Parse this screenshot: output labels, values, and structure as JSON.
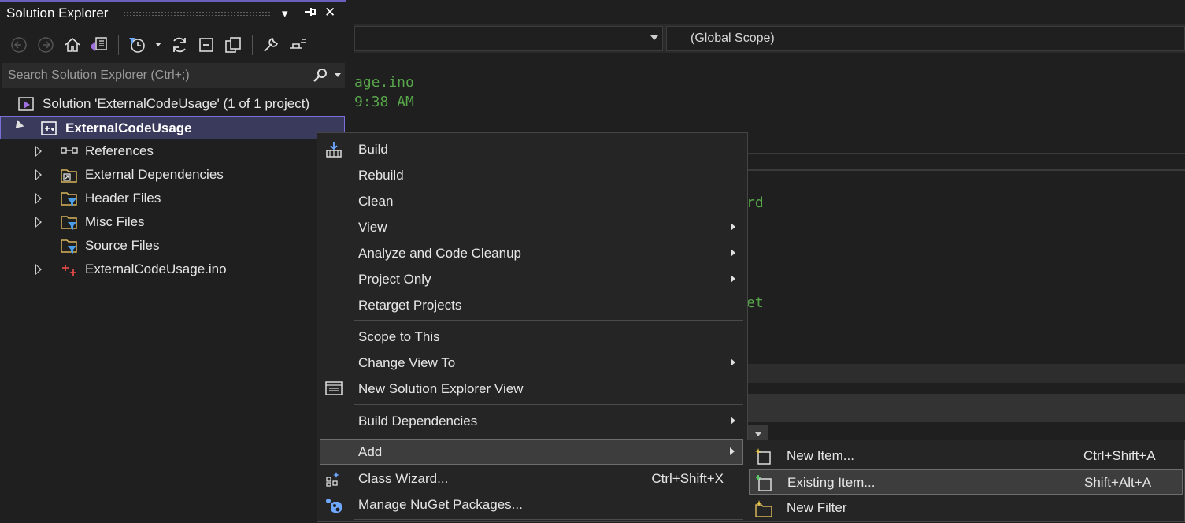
{
  "solution_explorer": {
    "title": "Solution Explorer",
    "title_buttons": {
      "dropdown": "▾",
      "pin": "⊣",
      "close": "✕"
    },
    "search_placeholder": "Search Solution Explorer (Ctrl+;)",
    "toolbar_icons": [
      "back-icon",
      "forward-icon",
      "home-icon",
      "switch-views-icon",
      "pending-changes-filter-icon",
      "sync-icon",
      "collapse-all-icon",
      "show-all-files-icon",
      "properties-icon",
      "preview-icon"
    ],
    "tree": {
      "solution": "Solution 'ExternalCodeUsage' (1 of 1 project)",
      "project": "ExternalCodeUsage",
      "items": [
        {
          "label": "References",
          "icon": "references-icon",
          "expandable": true
        },
        {
          "label": "External Dependencies",
          "icon": "external-deps-icon",
          "expandable": true
        },
        {
          "label": "Header Files",
          "icon": "filter-folder-icon",
          "expandable": true
        },
        {
          "label": "Misc Files",
          "icon": "filter-folder-icon",
          "expandable": true
        },
        {
          "label": "Source Files",
          "icon": "filter-folder-icon",
          "expandable": false
        },
        {
          "label": "ExternalCodeUsage.ino",
          "icon": "ino-file-icon",
          "expandable": true
        }
      ]
    }
  },
  "editor": {
    "scope": "(Global Scope)",
    "code_lines": [
      "age.ino",
      "9:38 AM",
      "rd",
      "et"
    ]
  },
  "context_menu": {
    "items": [
      {
        "label": "Build",
        "icon": "build-icon"
      },
      {
        "label": "Rebuild"
      },
      {
        "label": "Clean"
      },
      {
        "label": "View",
        "submenu": true
      },
      {
        "label": "Analyze and Code Cleanup",
        "submenu": true
      },
      {
        "label": "Project Only",
        "submenu": true
      },
      {
        "label": "Retarget Projects"
      },
      {
        "label": "Scope to This"
      },
      {
        "label": "Change View To",
        "submenu": true
      },
      {
        "label": "New Solution Explorer View",
        "icon": "new-se-view-icon"
      },
      {
        "label": "Build Dependencies",
        "submenu": true
      },
      {
        "label": "Add",
        "submenu": true,
        "highlighted": true
      },
      {
        "label": "Class Wizard...",
        "shortcut": "Ctrl+Shift+X",
        "icon": "class-wizard-icon"
      },
      {
        "label": "Manage NuGet Packages...",
        "icon": "nuget-icon"
      }
    ]
  },
  "add_submenu": {
    "items": [
      {
        "label": "New Item...",
        "shortcut": "Ctrl+Shift+A",
        "icon": "new-item-icon"
      },
      {
        "label": "Existing Item...",
        "shortcut": "Shift+Alt+A",
        "icon": "existing-item-icon",
        "highlighted": true
      },
      {
        "label": "New Filter",
        "icon": "new-filter-icon"
      }
    ]
  },
  "colors": {
    "accent": "#6b5fbd",
    "selection": "#3a3b5c",
    "code_green": "#57a64a",
    "menu_bg": "#252526"
  }
}
